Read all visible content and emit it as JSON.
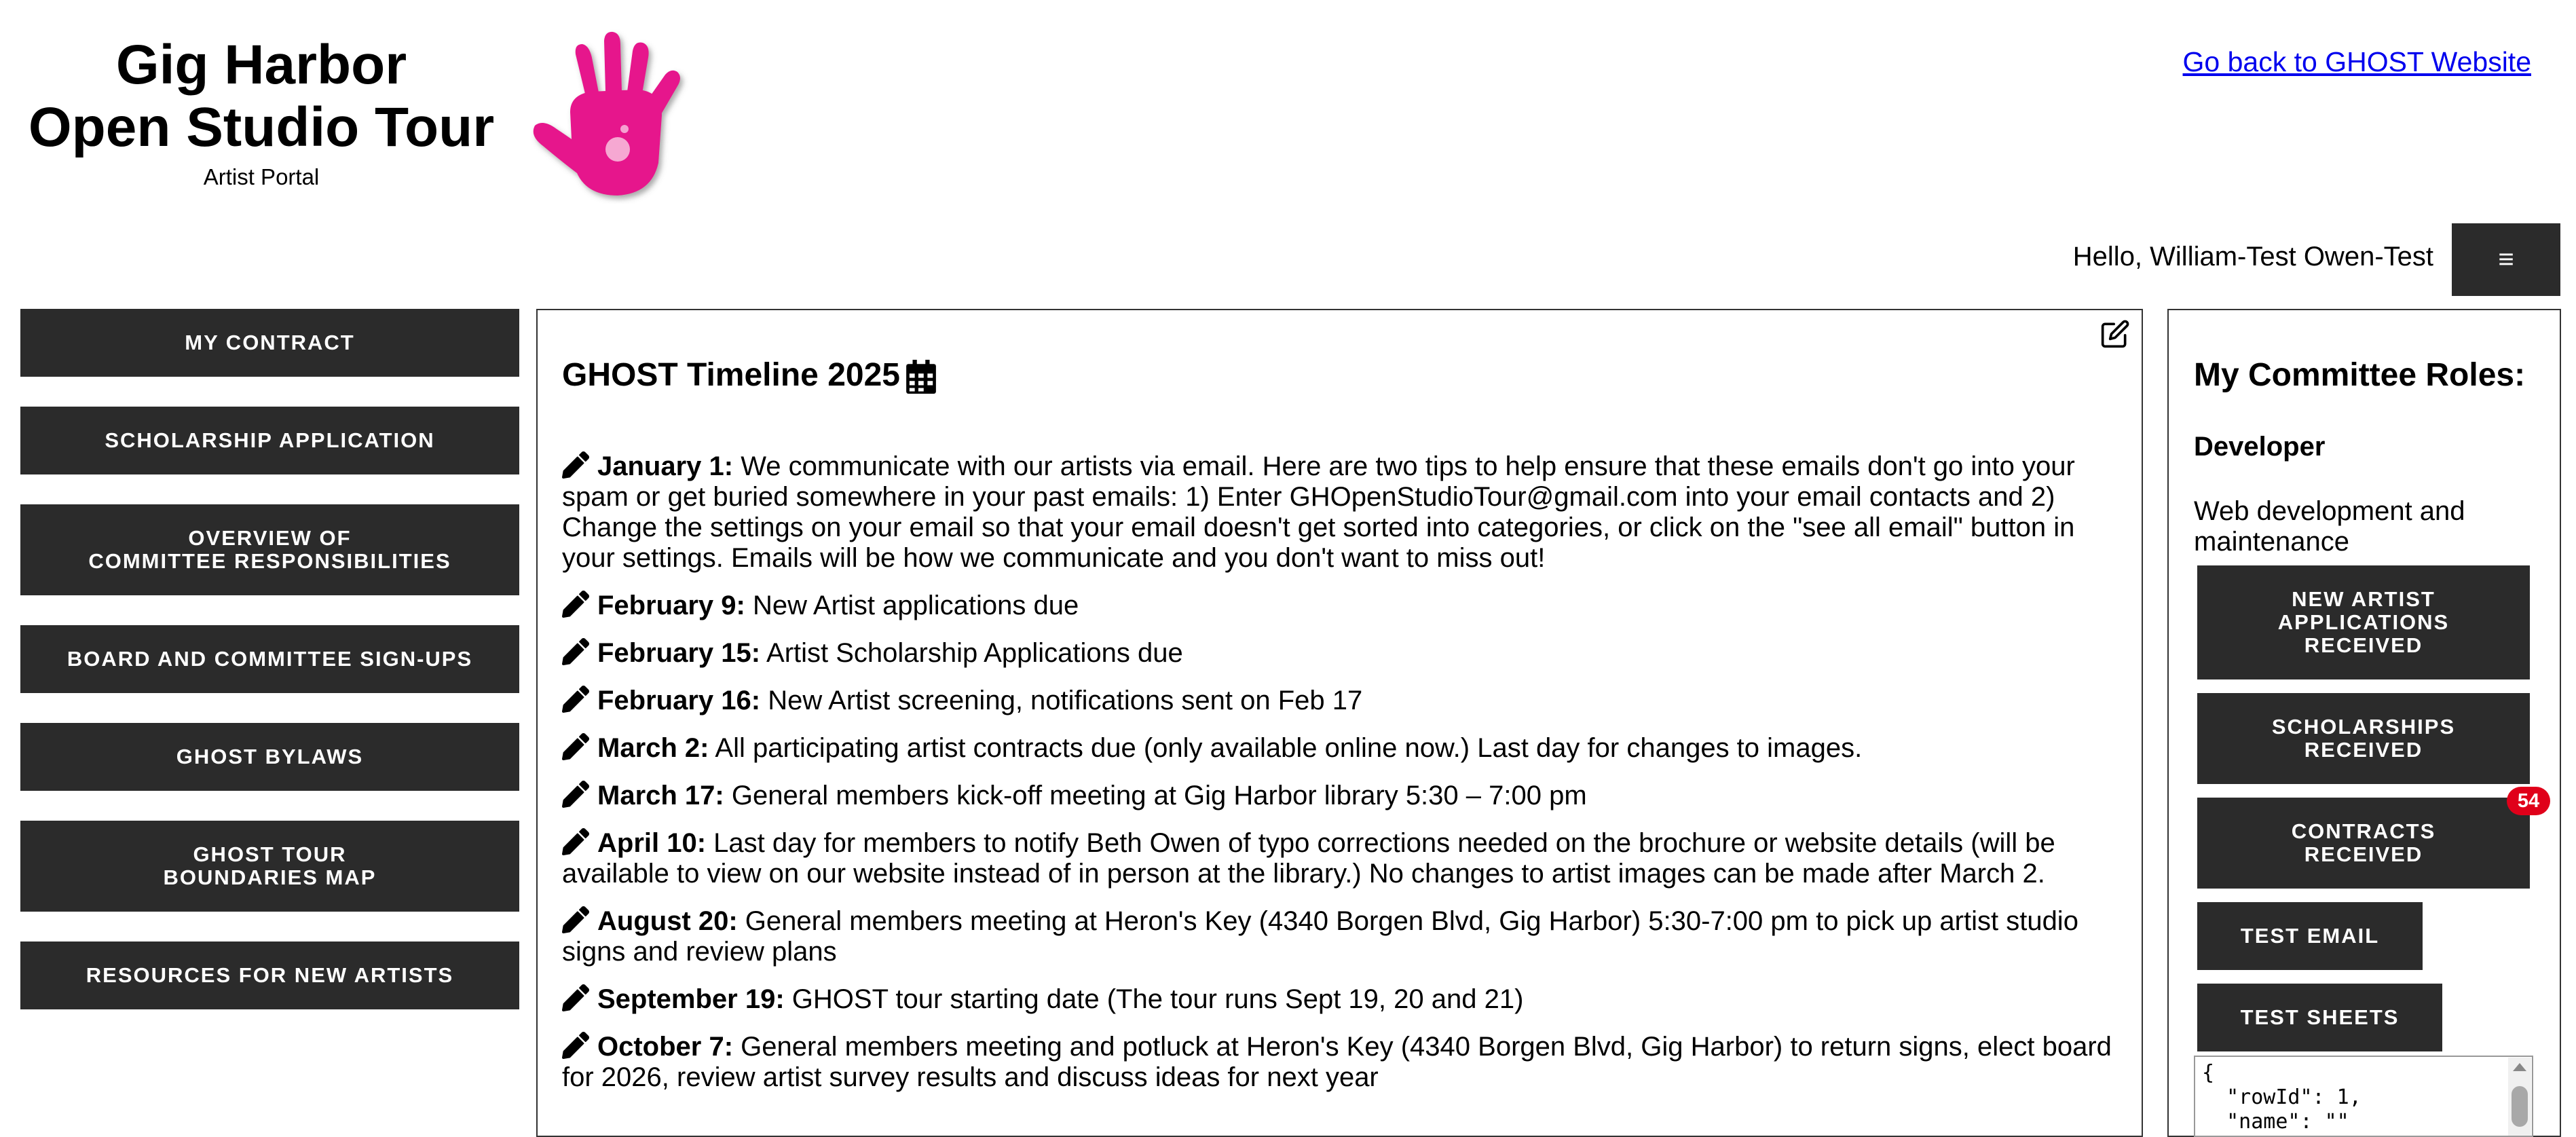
{
  "header": {
    "title_line1": "Gig Harbor",
    "title_line2": "Open Studio Tour",
    "subtitle": "Artist Portal",
    "logo_icon": "pink-handprint-icon",
    "back_link": "Go back to GHOST Website",
    "greeting": "Hello, William-Test Owen-Test",
    "menu_icon": "≡"
  },
  "nav": {
    "items": [
      {
        "label": "MY CONTRACT"
      },
      {
        "label": "SCHOLARSHIP APPLICATION"
      },
      {
        "label_line1": "OVERVIEW OF",
        "label_line2": "COMMITTEE RESPONSIBILITIES"
      },
      {
        "label": "BOARD AND COMMITTEE SIGN-UPS"
      },
      {
        "label": "GHOST BYLAWS"
      },
      {
        "label_line1": "GHOST TOUR",
        "label_line2": "BOUNDARIES MAP"
      },
      {
        "label": "RESOURCES FOR NEW ARTISTS"
      }
    ]
  },
  "timeline": {
    "title": "GHOST Timeline 2025",
    "items": [
      {
        "date": "January 1:",
        "text": " We communicate with our artists via email. Here are two tips to help ensure that these emails don't go into your spam or get buried somewhere in your past emails: 1) Enter GHOpenStudioTour@gmail.com into your email contacts and 2) Change the settings on your email so that your email doesn't get sorted into categories, or click on the \"see all email\" button in your settings. Emails will be how we communicate and you don't want to miss out!"
      },
      {
        "date": "February 9:",
        "text": " New Artist applications due"
      },
      {
        "date": "February 15:",
        "text": " Artist Scholarship Applications due"
      },
      {
        "date": "February 16:",
        "text": " New Artist screening, notifications sent on Feb 17"
      },
      {
        "date": "March 2:",
        "text": " All participating artist contracts due (only available online now.) Last day for changes to images."
      },
      {
        "date": "March 17:",
        "text": " General members kick-off meeting at Gig Harbor library 5:30 – 7:00 pm"
      },
      {
        "date": "April 10:",
        "text": " Last day for members to notify Beth Owen of typo corrections needed on the brochure or website details (will be available to view on our website instead of in person at the library.) No changes to artist images can be made after March 2."
      },
      {
        "date": "August 20:",
        "text": " General members meeting at Heron's Key (4340 Borgen Blvd, Gig Harbor) 5:30-7:00 pm to pick up artist studio signs and review plans"
      },
      {
        "date": "September 19:",
        "text": " GHOST tour starting date (The tour runs Sept 19, 20 and 21)"
      },
      {
        "date": "October 7:",
        "text": " General members meeting and potluck at Heron's Key (4340 Borgen Blvd, Gig Harbor) to return signs, elect board for 2026, review artist survey results and discuss ideas for next year"
      }
    ]
  },
  "roles": {
    "title": "My Committee Roles:",
    "role_name": "Developer",
    "role_desc": "Web development and maintenance",
    "buttons": [
      {
        "line1": "NEW ARTIST",
        "line2": "APPLICATIONS",
        "line3": "RECEIVED"
      },
      {
        "line1": "SCHOLARSHIPS",
        "line2": "RECEIVED"
      },
      {
        "line1": "CONTRACTS",
        "line2": "RECEIVED",
        "badge": "54"
      },
      {
        "label": "TEST EMAIL"
      },
      {
        "label": "TEST SHEETS"
      }
    ],
    "json_preview": "{\n  \"rowId\": 1,\n  \"name\": \"\""
  },
  "colors": {
    "button_bg": "#2b2b2b",
    "badge_bg": "#e0001a",
    "logo_pink": "#e6198c",
    "link": "#0000ee"
  }
}
